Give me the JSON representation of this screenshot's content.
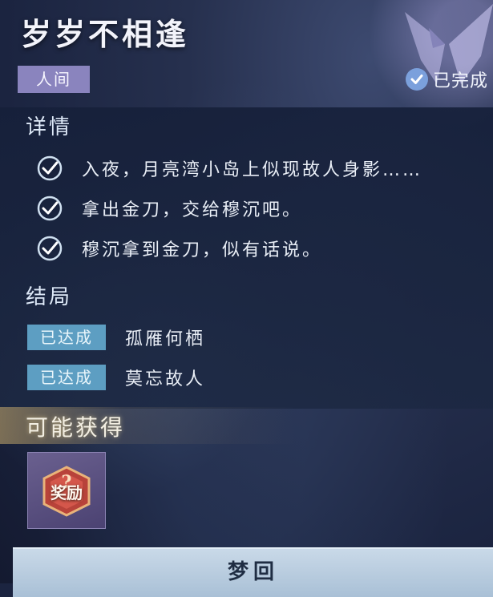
{
  "quest": {
    "title": "岁岁不相逢",
    "category": "人间",
    "status": "已完成"
  },
  "details": {
    "title": "详情",
    "items": [
      "入夜，月亮湾小岛上似现故人身影……",
      "拿出金刀，交给穆沉吧。",
      "穆沉拿到金刀，似有话说。"
    ]
  },
  "endings": {
    "title": "结局",
    "items": [
      {
        "badge": "已达成",
        "name": "孤雁何栖"
      },
      {
        "badge": "已达成",
        "name": "莫忘故人"
      }
    ]
  },
  "rewards": {
    "title": "可能获得",
    "items": [
      {
        "label": "奖励",
        "icon": "reward-question-icon"
      }
    ]
  },
  "action": {
    "label": "梦回"
  },
  "colors": {
    "tag_bg": "#8a84be",
    "badge_bg": "#5d9ec2",
    "check": "#7ba0dc"
  }
}
